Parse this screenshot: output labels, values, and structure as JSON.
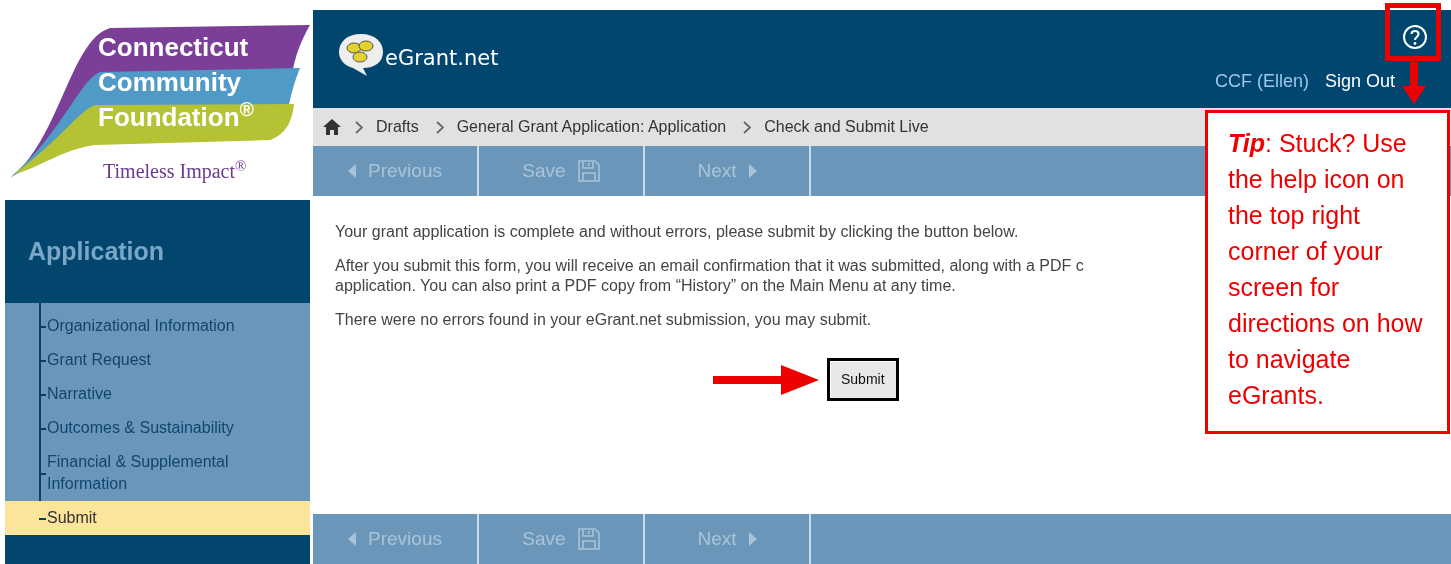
{
  "logo": {
    "lines": [
      "Connecticut",
      "Community",
      "Foundation$^{®}$"
    ],
    "tagline": "Timeless Impact$^{®}$"
  },
  "header": {
    "brand": "eGrant.net",
    "user": "CCF (Ellen)",
    "sign_out": "Sign Out"
  },
  "breadcrumb": [
    "Drafts",
    "General Grant Application: Application",
    "Check and Submit Live"
  ],
  "toolbar_top": [
    {
      "label": "Previous",
      "kind": "prev",
      "disabled": true
    },
    {
      "label": "Save",
      "kind": "save",
      "disabled": true
    },
    {
      "label": "Next",
      "kind": "next",
      "disabled": true
    }
  ],
  "sidebar": {
    "title": "Application",
    "items": [
      {
        "label": "Organizational Information",
        "selected": false
      },
      {
        "label": "Grant Request",
        "selected": false
      },
      {
        "label": "Narrative",
        "selected": false
      },
      {
        "label": "Outcomes & Sustainability",
        "selected": false
      },
      {
        "label": "Financial & Supplemental Information",
        "selected": false
      },
      {
        "label": "Submit",
        "selected": true
      }
    ]
  },
  "content": {
    "paragraphs": [
      {
        "lines": [
          "Your grant application is complete and without errors, please submit by clicking the button below."
        ]
      },
      {
        "lines": [
          "After you submit this form, you will receive an email confirmation that it was submitted, along with a PDF c",
          "application. You can also print a PDF copy from “History” on the Main Menu at any time."
        ]
      },
      {
        "lines": [
          "There were no errors found in your eGrant.net submission, you may submit."
        ]
      }
    ],
    "submit": "Submit"
  },
  "toolbar_bottom": [
    {
      "label": "Previous",
      "kind": "prev",
      "disabled": true
    },
    {
      "label": "Save",
      "kind": "save",
      "disabled": true
    },
    {
      "label": "Next",
      "kind": "next",
      "disabled": true
    }
  ],
  "tip": {
    "label": "Tip",
    "text": ": Stuck? Use the help icon on the top right corner of your screen for directions on how to navigate eGrants."
  }
}
